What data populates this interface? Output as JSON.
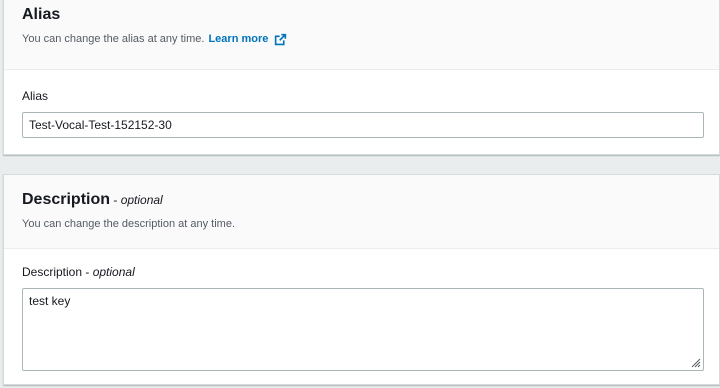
{
  "alias_section": {
    "title": "Alias",
    "description": "You can change the alias at any time.",
    "learn_more": "Learn more",
    "field_label": "Alias",
    "value": "Test-Vocal-Test-152152-30"
  },
  "description_section": {
    "title": "Description",
    "optional": "optional",
    "dash": " - ",
    "description": "You can change the description at any time.",
    "field_label": "Description",
    "value": "test key"
  },
  "colors": {
    "link": "#0073bb",
    "border": "#aab7b8",
    "background": "#eaeded"
  },
  "icons": {
    "external_link": "external-link-icon",
    "resize": "resize-handle-icon"
  }
}
